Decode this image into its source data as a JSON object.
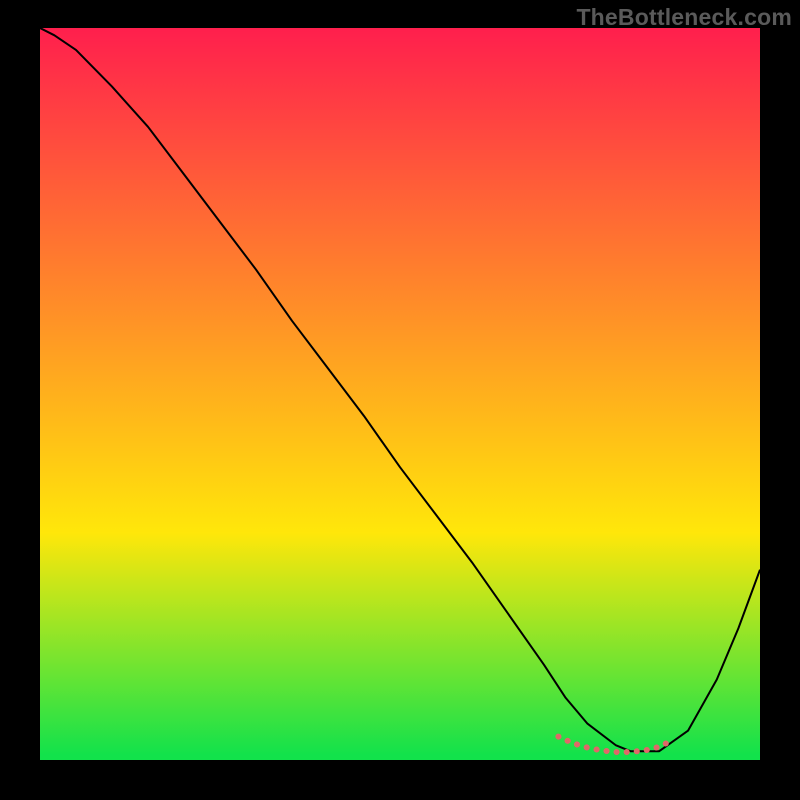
{
  "watermark": "TheBottleneck.com",
  "chart_data": {
    "type": "line",
    "title": "",
    "xlabel": "",
    "ylabel": "",
    "xlim": [
      0,
      100
    ],
    "ylim": [
      0,
      100
    ],
    "grid": false,
    "legend": false,
    "background_gradient": {
      "top_color": "#ff1f4d",
      "mid_color": "#ffe70a",
      "bottom_color": "#12e24b",
      "stops": [
        0,
        69,
        99.3
      ]
    },
    "series": [
      {
        "name": "bottleneck-curve",
        "color": "#000000",
        "stroke_width": 2,
        "x": [
          0,
          2,
          5,
          10,
          15,
          20,
          25,
          30,
          35,
          40,
          45,
          50,
          55,
          60,
          65,
          70,
          73,
          76,
          80,
          82,
          86,
          90,
          94,
          97,
          100
        ],
        "y": [
          100,
          99,
          97,
          92,
          86.5,
          80,
          73.5,
          67,
          60,
          53.5,
          47,
          40,
          33.5,
          27,
          20,
          13,
          8.5,
          5,
          2,
          1.2,
          1.2,
          4,
          11,
          18,
          26
        ]
      },
      {
        "name": "optimal-zone-highlight",
        "color": "#e06868",
        "stroke_width": 6,
        "stroke_dash": "0.1 10",
        "stroke_linecap": "round",
        "x": [
          72,
          74,
          76,
          78,
          80,
          82,
          84,
          86,
          88
        ],
        "y": [
          3.2,
          2.3,
          1.7,
          1.3,
          1.1,
          1.1,
          1.3,
          1.8,
          2.8
        ]
      }
    ],
    "annotations": []
  }
}
